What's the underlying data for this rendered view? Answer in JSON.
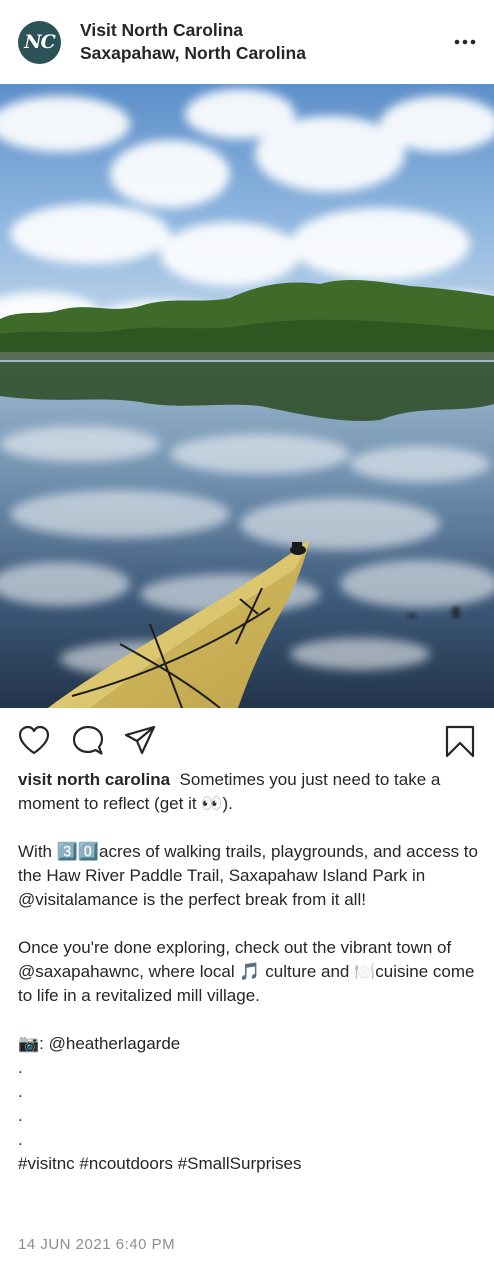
{
  "header": {
    "avatar_text": "NC",
    "account_name": "Visit North Carolina",
    "location": "Saxapahaw, North Carolina",
    "more_icon": "more-horizontal-icon"
  },
  "photo": {
    "description_icon": "kayak-lake-photo"
  },
  "actions": {
    "like_icon": "heart-icon",
    "comment_icon": "comment-icon",
    "share_icon": "share-icon",
    "save_icon": "bookmark-icon"
  },
  "caption": {
    "username": "visit north carolina",
    "line1": "Sometimes you just need to take a moment to reflect (get it 👀).",
    "para2": "With 3️⃣0️⃣acres of walking trails, playgrounds, and access to the Haw River Paddle Trail, Saxapahaw Island Park in @visitalamance is the perfect break from it all!",
    "para3": "Once you're done exploring, check out the vibrant town of @saxapahawnc, where local 🎵 culture and 🍽️cuisine come to life in a revitalized mill village.",
    "photo_credit": "📷: @heatherlagarde",
    "dots": [
      ".",
      ".",
      ".",
      "."
    ],
    "hashtags": "#visitnc #ncoutdoors #SmallSurprises"
  },
  "timestamp": "14 JUN 2021 6:40 PM",
  "colors": {
    "avatar_bg": "#2a5257",
    "text": "#262626",
    "muted": "#8e8e8e"
  }
}
